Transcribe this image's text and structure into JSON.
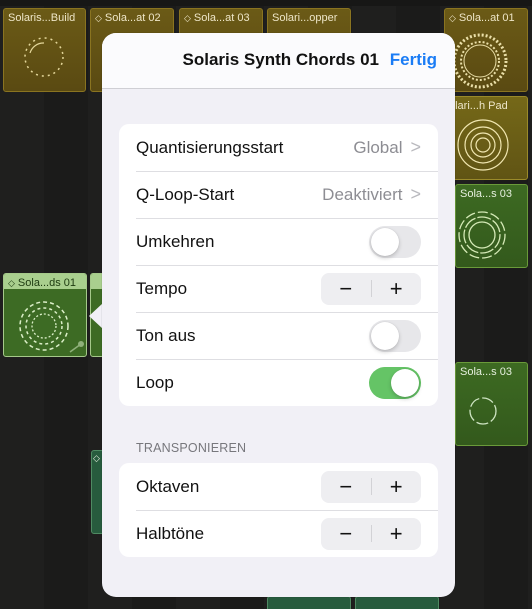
{
  "grid": {
    "cells": [
      {
        "id": "c1",
        "title": "Solaris...Build",
        "chevron": false,
        "color": "gold"
      },
      {
        "id": "c2",
        "title": "Sola...at 02",
        "chevron": true,
        "color": "gold"
      },
      {
        "id": "c3",
        "title": "Sola...at 03",
        "chevron": true,
        "color": "gold"
      },
      {
        "id": "c4",
        "title": "Solari...opper",
        "chevron": false,
        "color": "gold"
      },
      {
        "id": "c5",
        "title": "Sola...at 01",
        "chevron": true,
        "color": "gold"
      },
      {
        "id": "c6",
        "title": "olari...h Pad",
        "chevron": false,
        "color": "gold-light"
      },
      {
        "id": "c7",
        "title": "Sola...s 03",
        "chevron": false,
        "color": "green"
      },
      {
        "id": "c8",
        "title": "Sola...ds 01",
        "chevron": true,
        "color": "green-selected"
      },
      {
        "id": "c9",
        "title": "Sola...s 03",
        "chevron": false,
        "color": "green"
      }
    ],
    "chevron_glyph": "◇"
  },
  "popover": {
    "title": "Solaris Synth Chords 01",
    "done_label": "Fertig",
    "rows": [
      {
        "label": "Quantisierungsstart",
        "type": "disclosure",
        "value": "Global"
      },
      {
        "label": "Q-Loop-Start",
        "type": "disclosure",
        "value": "Deaktiviert"
      },
      {
        "label": "Umkehren",
        "type": "toggle",
        "value": false
      },
      {
        "label": "Tempo",
        "type": "stepper",
        "minus": "−",
        "plus": "+"
      },
      {
        "label": "Ton aus",
        "type": "toggle",
        "value": false
      },
      {
        "label": "Loop",
        "type": "toggle",
        "value": true
      }
    ],
    "transpose_section": {
      "header": "TRANSPONIEREN",
      "rows": [
        {
          "label": "Oktaven",
          "type": "stepper",
          "minus": "−",
          "plus": "+"
        },
        {
          "label": "Halbtöne",
          "type": "stepper",
          "minus": "−",
          "plus": "+"
        }
      ]
    },
    "chevron_glyph": ">"
  },
  "colors": {
    "accent": "#1a7cf5",
    "toggle_on": "#65c466",
    "gold_cell": "#6b5a16",
    "green_cell": "#3d6a22",
    "teal_cell": "#275b3d"
  }
}
